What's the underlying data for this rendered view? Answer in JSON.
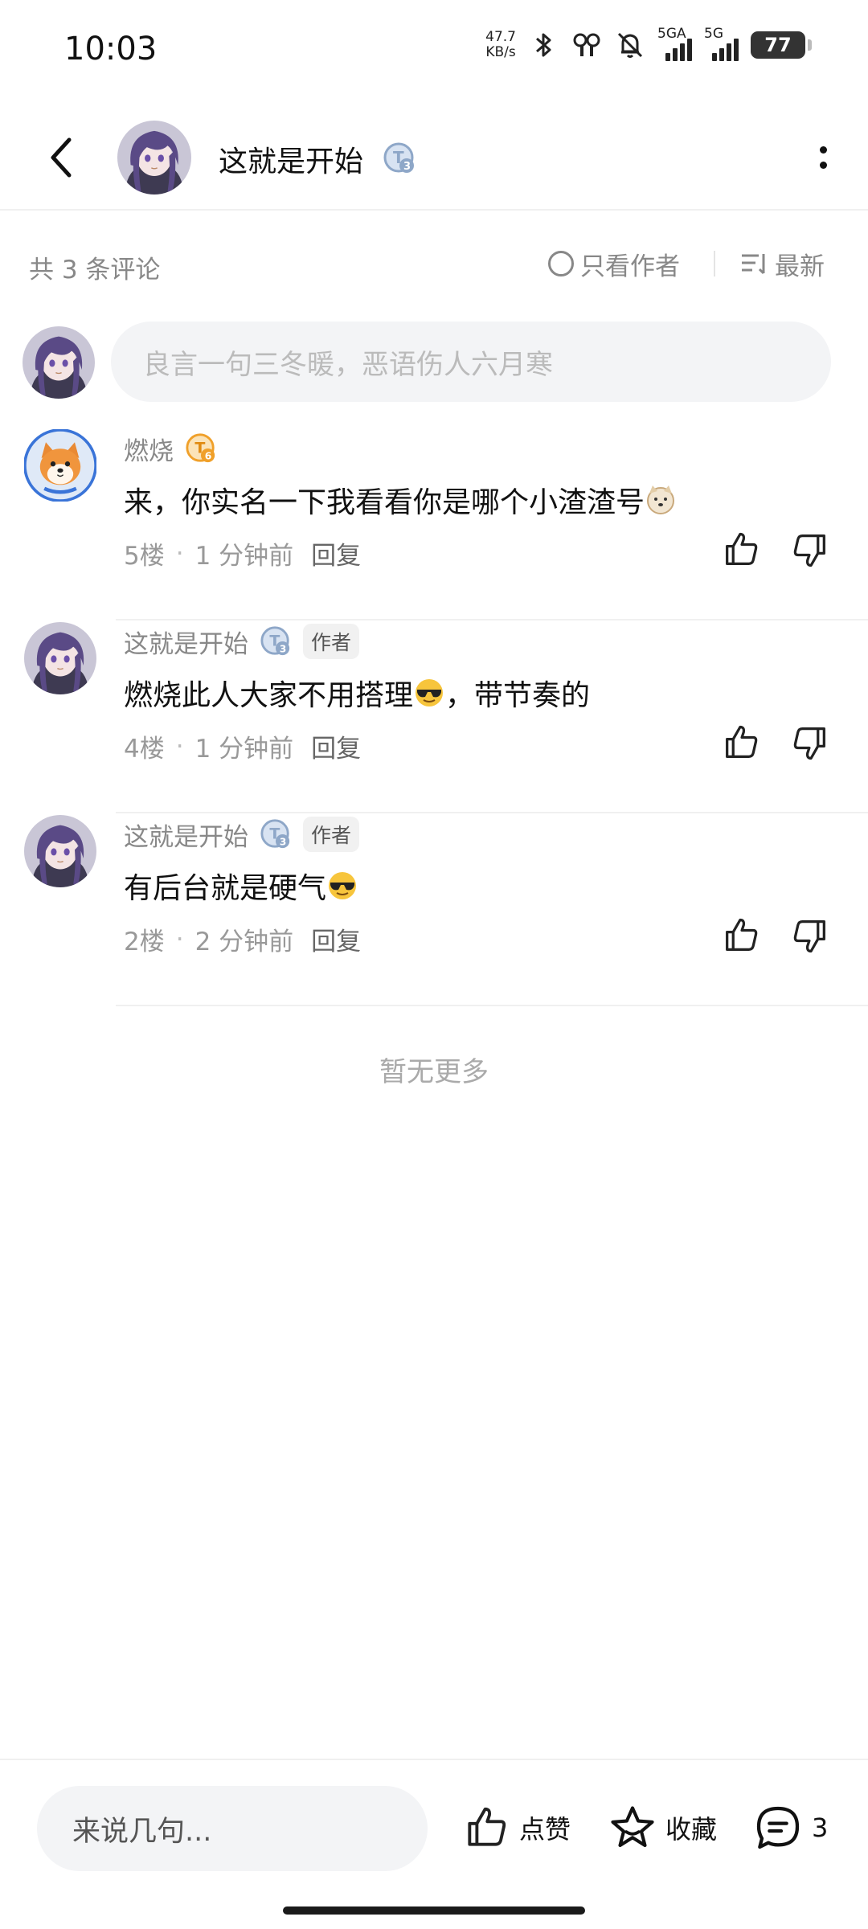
{
  "status_bar": {
    "time": "10:03",
    "net_speed_value": "47.7",
    "net_speed_unit": "KB/s",
    "sim1_label": "5GA",
    "sim2_label": "5G",
    "battery": "77",
    "icons": [
      "bluetooth-icon",
      "earbuds-icon",
      "bell-muted-icon",
      "signal-icon",
      "signal-icon",
      "battery-icon"
    ]
  },
  "header": {
    "title": "这就是开始",
    "level_badge": "3"
  },
  "filter": {
    "count_text": "共 3 条评论",
    "author_only_label": "只看作者",
    "sort_label": "最新"
  },
  "comment_input": {
    "placeholder": "良言一句三冬暖，恶语伤人六月寒"
  },
  "comments": [
    {
      "name": "燃烧",
      "level": "6",
      "is_author": false,
      "text": "来，你实名一下我看看你是哪个小渣渣号",
      "emoji": "doge-emoji",
      "floor": "5楼",
      "time": "1 分钟前",
      "reply_label": "回复"
    },
    {
      "name": "这就是开始",
      "level": "3",
      "is_author": true,
      "author_tag": "作者",
      "text_before": "燃烧此人大家不用搭理",
      "emoji": "sunglasses-emoji",
      "text_after": "，带节奏的",
      "floor": "4楼",
      "time": "1 分钟前",
      "reply_label": "回复"
    },
    {
      "name": "这就是开始",
      "level": "3",
      "is_author": true,
      "author_tag": "作者",
      "text": "有后台就是硬气",
      "emoji": "sunglasses-emoji",
      "floor": "2楼",
      "time": "2 分钟前",
      "reply_label": "回复"
    }
  ],
  "no_more_text": "暂无更多",
  "bottom_bar": {
    "input_placeholder": "来说几句...",
    "like_label": "点赞",
    "favorite_label": "收藏",
    "comment_count": "3"
  },
  "colors": {
    "text_primary": "#111111",
    "text_secondary": "#888888",
    "input_bg": "#f3f4f6",
    "level_badge_blue": "#8ea7c8",
    "level_badge_orange": "#f0a02a"
  }
}
